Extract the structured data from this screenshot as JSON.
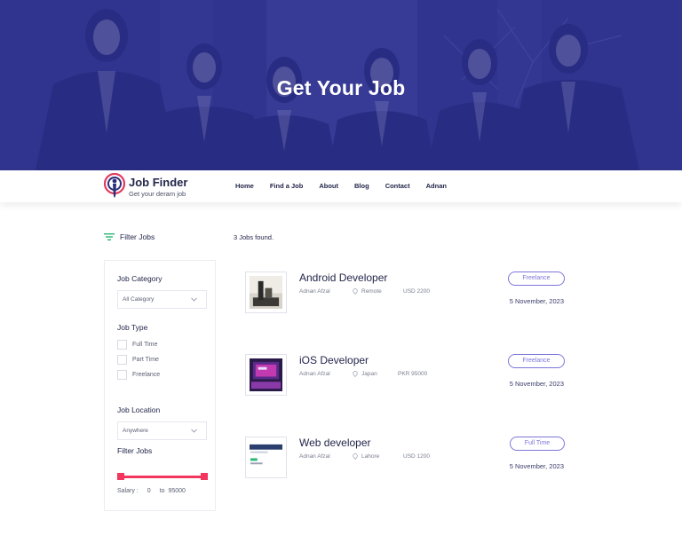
{
  "hero": {
    "title": "Get Your Job"
  },
  "brand": {
    "name": "Job Finder",
    "tagline": "Get your deram job"
  },
  "nav": {
    "items": [
      {
        "label": "Home"
      },
      {
        "label": "Find a Job"
      },
      {
        "label": "About"
      },
      {
        "label": "Blog"
      },
      {
        "label": "Contact"
      },
      {
        "label": "Adnan"
      }
    ]
  },
  "filter": {
    "title": "Filter Jobs",
    "jobs_found": "3 Jobs found.",
    "category": {
      "label": "Job Category",
      "selected": "All Category"
    },
    "type": {
      "label": "Job Type",
      "options": [
        {
          "label": "Full Time",
          "checked": false
        },
        {
          "label": "Part Time",
          "checked": false
        },
        {
          "label": "Freelance",
          "checked": false
        }
      ]
    },
    "location": {
      "label": "Job Location",
      "selected": "Anywhere"
    },
    "range": {
      "label": "Filter Jobs",
      "salary_label": "Salary :",
      "min": "0",
      "to": "to",
      "max": "95000"
    }
  },
  "jobs": [
    {
      "title": "Android Developer",
      "company": "Adnan Afzal",
      "location": "Remote",
      "salary": "USD 2200",
      "type": "Freelance",
      "date": "5 November, 2023"
    },
    {
      "title": "iOS Developer",
      "company": "Adnan Afzal",
      "location": "Japan",
      "salary": "PKR 95000",
      "type": "Freelance",
      "date": "5 November, 2023"
    },
    {
      "title": "Web developer",
      "company": "Adnan Afzal",
      "location": "Lahore",
      "salary": "USD 1200",
      "type": "Full Time",
      "date": "5 November, 2023"
    }
  ],
  "colors": {
    "hero_overlay": "#2c2f8c",
    "accent": "#7c76d8",
    "range": "#f2365d",
    "filter_icon": "#2bb673"
  }
}
